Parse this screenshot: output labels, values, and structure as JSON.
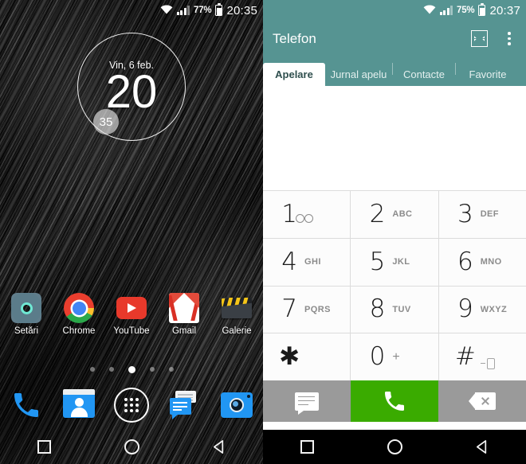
{
  "left_pane": {
    "name": "android-home-screen",
    "status_bar": {
      "wifi_icon": "wifi-icon",
      "signal_icon": "cellular-signal-icon",
      "battery_percent": "77%",
      "battery_icon": "battery-icon",
      "clock": "20:35"
    },
    "clock_widget": {
      "date": "Vin, 6 feb.",
      "hour": "20",
      "minute": "35"
    },
    "app_row": [
      {
        "label": "Setări",
        "icon": "settings-gear-icon"
      },
      {
        "label": "Chrome",
        "icon": "chrome-icon"
      },
      {
        "label": "YouTube",
        "icon": "youtube-icon"
      },
      {
        "label": "Gmail",
        "icon": "gmail-icon"
      },
      {
        "label": "Galerie",
        "icon": "gallery-clapperboard-icon"
      }
    ],
    "page_dots": {
      "count": 5,
      "active_index": 2
    },
    "dock": [
      {
        "name": "phone",
        "icon": "phone-handset-icon"
      },
      {
        "name": "contacts",
        "icon": "contacts-icon"
      },
      {
        "name": "app-drawer",
        "icon": "app-drawer-icon"
      },
      {
        "name": "messages",
        "icon": "messages-icon"
      },
      {
        "name": "camera",
        "icon": "camera-icon"
      }
    ],
    "nav_bar": [
      {
        "name": "recents",
        "icon": "square-icon"
      },
      {
        "name": "home",
        "icon": "circle-icon"
      },
      {
        "name": "back",
        "icon": "triangle-back-icon"
      }
    ]
  },
  "right_pane": {
    "name": "phone-dialer-app",
    "status_bar": {
      "wifi_icon": "wifi-icon",
      "signal_icon": "cellular-signal-icon",
      "battery_percent": "75%",
      "battery_icon": "battery-icon",
      "clock": "20:37"
    },
    "app_bar": {
      "title": "Telefon",
      "shrink_icon": "shrink-screen-icon",
      "overflow_icon": "overflow-menu-icon"
    },
    "tabs": [
      {
        "label": "Apelare",
        "active": true
      },
      {
        "label": "Jurnal apelu",
        "active": false
      },
      {
        "label": "Contacte",
        "active": false
      },
      {
        "label": "Favorite",
        "active": false
      }
    ],
    "dial_input": {
      "value": "",
      "placeholder": ""
    },
    "keypad": [
      {
        "num": "1",
        "sub": "",
        "icon": "voicemail-icon"
      },
      {
        "num": "2",
        "sub": "ABC",
        "icon": ""
      },
      {
        "num": "3",
        "sub": "DEF",
        "icon": ""
      },
      {
        "num": "4",
        "sub": "GHI",
        "icon": ""
      },
      {
        "num": "5",
        "sub": "JKL",
        "icon": ""
      },
      {
        "num": "6",
        "sub": "MNO",
        "icon": ""
      },
      {
        "num": "7",
        "sub": "PQRS",
        "icon": ""
      },
      {
        "num": "8",
        "sub": "TUV",
        "icon": ""
      },
      {
        "num": "9",
        "sub": "WXYZ",
        "icon": ""
      },
      {
        "num": "✱",
        "sub": "",
        "icon": ""
      },
      {
        "num": "0",
        "sub": "+",
        "icon": ""
      },
      {
        "num": "#",
        "sub": "",
        "icon": "vibrate-icon"
      }
    ],
    "action_bar": [
      {
        "name": "message-button",
        "icon": "message-icon",
        "color": "#9a9a9a"
      },
      {
        "name": "call-button",
        "icon": "call-icon",
        "color": "#3aab00"
      },
      {
        "name": "backspace-button",
        "icon": "backspace-icon",
        "color": "#9a9a9a"
      }
    ],
    "nav_bar": [
      {
        "name": "recents",
        "icon": "square-icon"
      },
      {
        "name": "home",
        "icon": "circle-icon"
      },
      {
        "name": "back",
        "icon": "triangle-back-icon"
      }
    ]
  },
  "colors": {
    "teal_accent": "#569492",
    "call_green": "#3aab00",
    "action_grey": "#9a9a9a",
    "nav_black": "#000000"
  }
}
